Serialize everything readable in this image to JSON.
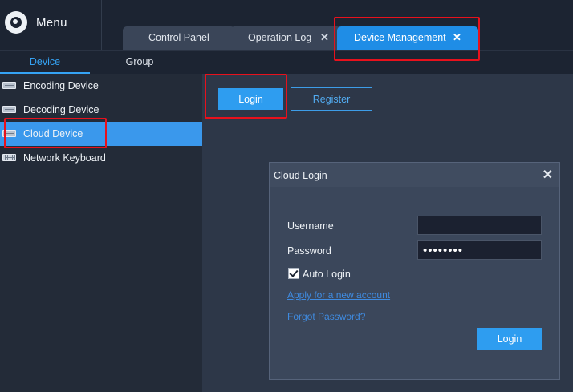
{
  "header": {
    "menu_label": "Menu",
    "tabs": [
      {
        "label": "Control Panel",
        "closable": false,
        "active": false
      },
      {
        "label": "Operation Log",
        "closable": true,
        "active": false
      },
      {
        "label": "Device Management",
        "closable": true,
        "active": true
      }
    ],
    "close_glyph": "✕"
  },
  "subtabs": [
    {
      "label": "Device",
      "active": true
    },
    {
      "label": "Group",
      "active": false
    }
  ],
  "sidebar": {
    "items": [
      {
        "label": "Encoding Device",
        "icon": "encoder-icon",
        "active": false
      },
      {
        "label": "Decoding Device",
        "icon": "decoder-icon",
        "active": false
      },
      {
        "label": "Cloud Device",
        "icon": "cloud-device-icon",
        "active": true
      },
      {
        "label": "Network Keyboard",
        "icon": "keyboard-icon",
        "active": false
      }
    ]
  },
  "main": {
    "login_button": "Login",
    "register_button": "Register"
  },
  "dialog": {
    "title": "Cloud Login",
    "close_glyph": "✕",
    "username_label": "Username",
    "username_value": "",
    "password_label": "Password",
    "password_value": "••••••••",
    "auto_login_label": "Auto Login",
    "auto_login_checked": true,
    "apply_link": "Apply for a new account",
    "forgot_link": "Forgot Password?",
    "login_button": "Login"
  },
  "colors": {
    "accent": "#2e9df0",
    "active_tab": "#1f8de6",
    "annotation": "#e8111c"
  }
}
